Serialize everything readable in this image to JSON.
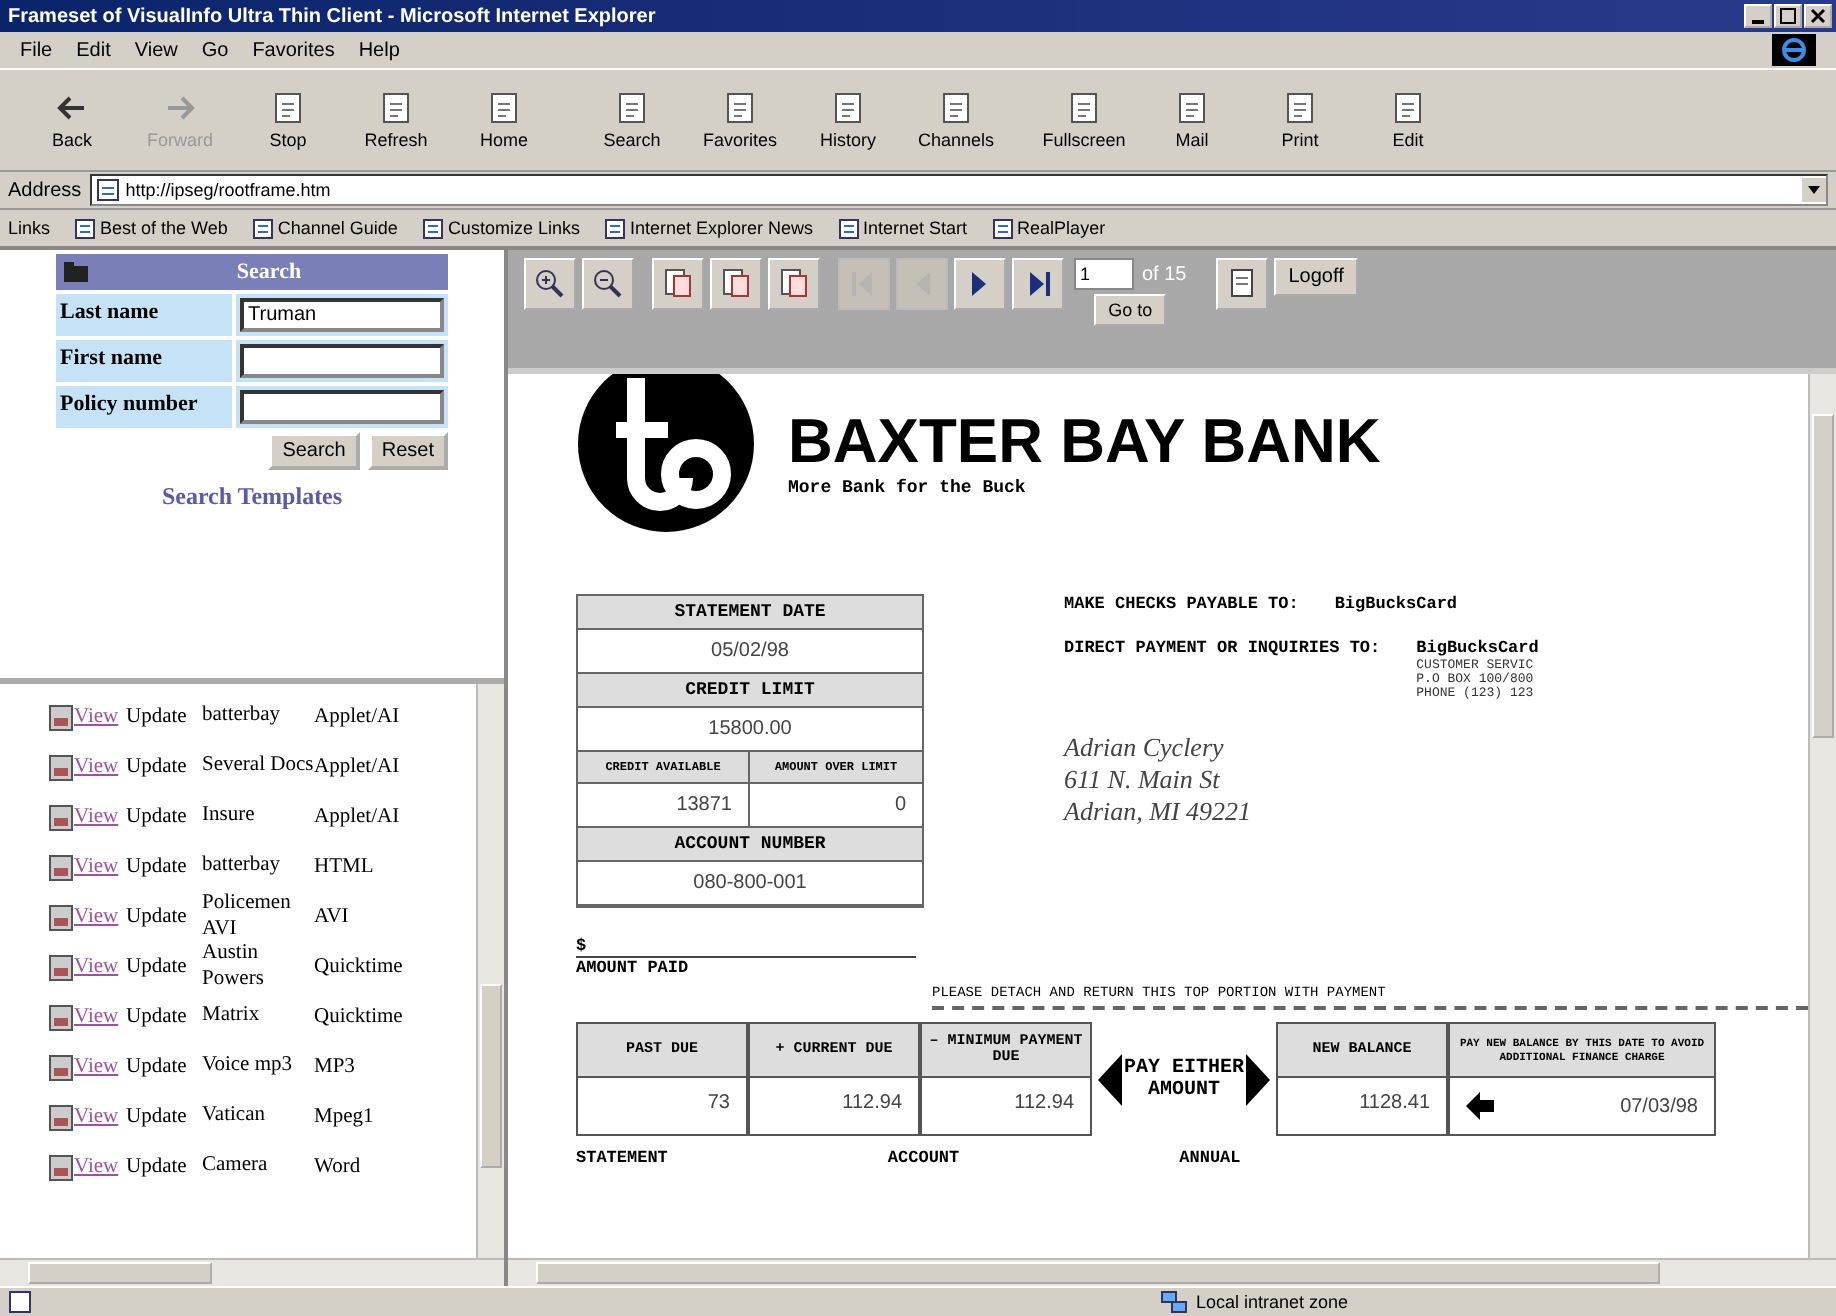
{
  "window": {
    "title": "Frameset of VisualInfo Ultra Thin Client - Microsoft Internet Explorer"
  },
  "menu": [
    "File",
    "Edit",
    "View",
    "Go",
    "Favorites",
    "Help"
  ],
  "toolbar": [
    {
      "label": "Back",
      "disabled": false
    },
    {
      "label": "Forward",
      "disabled": true
    },
    {
      "label": "Stop",
      "disabled": false
    },
    {
      "label": "Refresh",
      "disabled": false
    },
    {
      "label": "Home",
      "disabled": false
    },
    {
      "label": "Search",
      "disabled": false
    },
    {
      "label": "Favorites",
      "disabled": false
    },
    {
      "label": "History",
      "disabled": false
    },
    {
      "label": "Channels",
      "disabled": false
    },
    {
      "label": "Fullscreen",
      "disabled": false
    },
    {
      "label": "Mail",
      "disabled": false
    },
    {
      "label": "Print",
      "disabled": false
    },
    {
      "label": "Edit",
      "disabled": false
    }
  ],
  "address": {
    "label": "Address",
    "value": "http://ipseg/rootframe.htm"
  },
  "links": {
    "label": "Links",
    "items": [
      "Best of the Web",
      "Channel Guide",
      "Customize Links",
      "Internet Explorer News",
      "Internet Start",
      "RealPlayer"
    ]
  },
  "search": {
    "title": "Search",
    "fields": [
      {
        "label": "Last name",
        "value": "Truman"
      },
      {
        "label": "First name"
      },
      {
        "label": "Policy number"
      }
    ],
    "buttons": [
      "Search",
      "Reset"
    ],
    "link": "Search Templates"
  },
  "documents": [
    {
      "view": "View",
      "update": "Update",
      "name": "batterbay",
      "type": "Applet/AI"
    },
    {
      "view": "View",
      "update": "Update",
      "name": "Several Docs",
      "type": "Applet/AI"
    },
    {
      "view": "View",
      "update": "Update",
      "name": "Insure",
      "type": "Applet/AI"
    },
    {
      "view": "View",
      "update": "Update",
      "name": "batterbay",
      "type": "HTML"
    },
    {
      "view": "View",
      "update": "Update",
      "name": "Policemen AVI",
      "type": "AVI"
    },
    {
      "view": "View",
      "update": "Update",
      "name": "Austin Powers",
      "type": "Quicktime"
    },
    {
      "view": "View",
      "update": "Update",
      "name": "Matrix",
      "type": "Quicktime"
    },
    {
      "view": "View",
      "update": "Update",
      "name": "Voice mp3",
      "type": "MP3"
    },
    {
      "view": "View",
      "update": "Update",
      "name": "Vatican",
      "type": "Mpeg1"
    },
    {
      "view": "View",
      "update": "Update",
      "name": "Camera",
      "type": "Word"
    }
  ],
  "viewer": {
    "tools": [
      {
        "kind": "zoom-in",
        "disabled": false
      },
      {
        "kind": "zoom-out",
        "disabled": false
      },
      {
        "kind": "page",
        "disabled": false
      },
      {
        "kind": "page",
        "disabled": false
      },
      {
        "kind": "page",
        "disabled": false
      },
      {
        "kind": "first",
        "disabled": true
      },
      {
        "kind": "prev",
        "disabled": true
      },
      {
        "kind": "next",
        "disabled": false
      },
      {
        "kind": "last",
        "disabled": false
      }
    ],
    "page": "1",
    "page_count": "of 15",
    "goto": "Go to",
    "logoff": "Logoff"
  },
  "statement": {
    "bank": "BAXTER BAY BANK",
    "tagline": "More Bank for the Buck",
    "statement_date_label": "STATEMENT DATE",
    "statement_date": "05/02/98",
    "credit_limit_label": "CREDIT LIMIT",
    "credit_limit": "15800.00",
    "credit_available_label": "CREDIT AVAILABLE",
    "over_limit_label": "AMOUNT OVER LIMIT",
    "credit_available": "13871",
    "over_limit": "0",
    "account_number_label": "ACCOUNT NUMBER",
    "account_number": "080-800-001",
    "payable_label": "MAKE CHECKS PAYABLE TO:",
    "payable_to": "BigBucksCard",
    "inquiries_label": "DIRECT PAYMENT OR INQUIRIES TO:",
    "inquiries_to": "BigBucksCard",
    "inquiries_lines": [
      "CUSTOMER SERVIC",
      "P.O BOX 100/800",
      "PHONE (123) 123"
    ],
    "customer_address": [
      "Adrian Cyclery",
      "611 N. Main St",
      "Adrian, MI 49221"
    ],
    "dollar": "$",
    "amount_paid_label": "AMOUNT PAID",
    "detach_note": "PLEASE DETACH AND RETURN THIS TOP PORTION WITH PAYMENT",
    "payment_columns": [
      {
        "label": "PAST DUE",
        "value": "73"
      },
      {
        "label": "+ CURRENT DUE",
        "value": "112.94"
      },
      {
        "label": "– MINIMUM PAYMENT DUE",
        "value": "112.94"
      }
    ],
    "pay_note": "PAY EITHER AMOUNT",
    "new_balance_label": "NEW BALANCE",
    "new_balance": "1128.41",
    "due_date_label": "PAY NEW BALANCE BY THIS DATE TO AVOID ADDITIONAL FINANCE CHARGE",
    "due_date": "07/03/98",
    "footer_labels": [
      "STATEMENT",
      "ACCOUNT",
      "ANNUAL"
    ]
  },
  "status_bar": {
    "zone": "Local intranet zone"
  }
}
